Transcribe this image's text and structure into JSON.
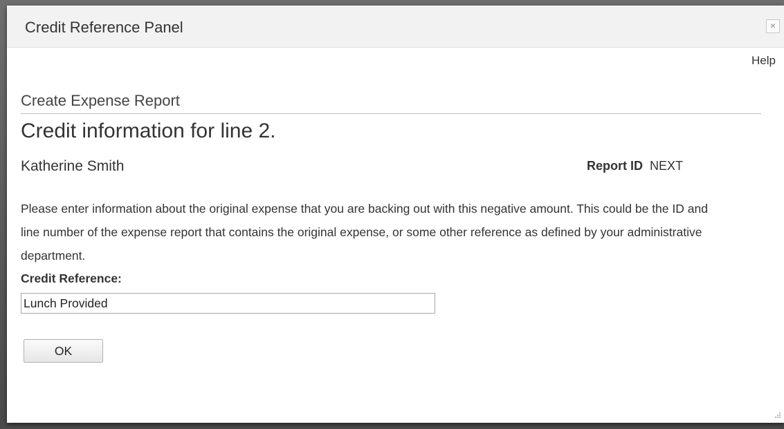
{
  "dialog": {
    "title": "Credit Reference Panel",
    "close_glyph": "×",
    "help_label": "Help"
  },
  "page": {
    "section_title": "Create Expense Report",
    "heading": "Credit information for line 2.",
    "employee_name": "Katherine Smith",
    "report_id_label": "Report ID",
    "report_id_value": "NEXT",
    "instructions": "Please enter information about the original expense that you are backing out with this negative amount. This could be the ID and line number of the expense report that contains the original expense, or some other reference as defined by your administrative department."
  },
  "form": {
    "credit_reference_label": "Credit Reference:",
    "credit_reference_value": "Lunch Provided",
    "ok_label": "OK"
  },
  "icons": {
    "close": "close-icon",
    "resize": "resize-grip-icon"
  }
}
